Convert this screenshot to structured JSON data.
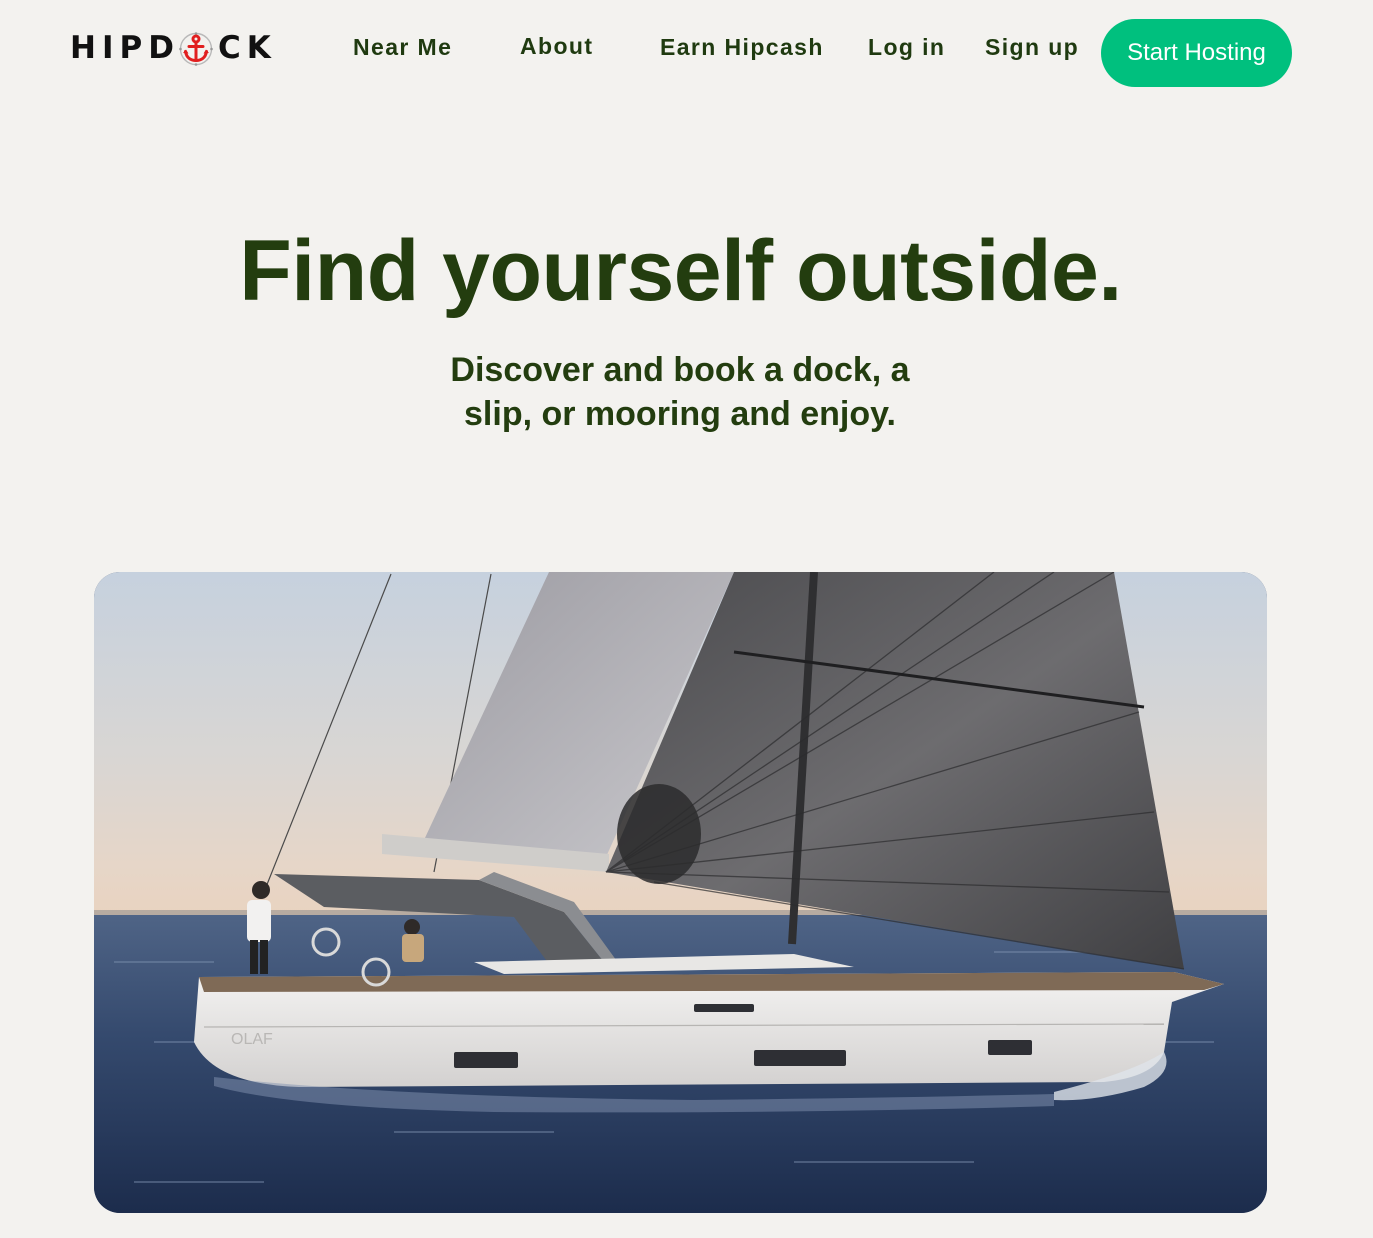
{
  "brand": {
    "left": "HIPD",
    "right": "CK",
    "accent_color": "#e11f1f"
  },
  "nav": {
    "items": [
      {
        "label": "Near Me"
      },
      {
        "label": "About"
      },
      {
        "label": "Earn Hipcash"
      },
      {
        "label": "Log in"
      },
      {
        "label": "Sign up"
      }
    ],
    "cta_label": "Start Hosting",
    "cta_color": "#00c07e",
    "text_color": "#1f3a10"
  },
  "hero": {
    "title": "Find yourself outside.",
    "subtitle": "Discover and book a dock, a slip, or mooring and enjoy.",
    "image": {
      "icon": "sailboat-photo",
      "hull_text": "OLAF"
    }
  }
}
